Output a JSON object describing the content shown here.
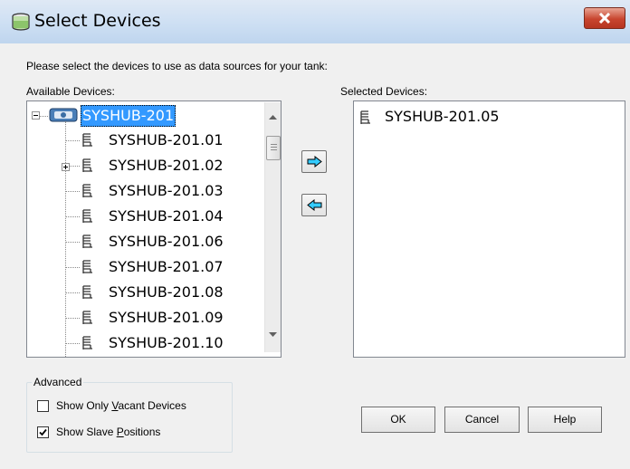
{
  "window": {
    "title": "Select Devices",
    "close_icon": "close-x-icon"
  },
  "instructions": "Please select the devices to use as data sources for your tank:",
  "available": {
    "label": "Available Devices:",
    "root": "SYSHUB-201",
    "items": [
      "SYSHUB-201.01",
      "SYSHUB-201.02",
      "SYSHUB-201.03",
      "SYSHUB-201.04",
      "SYSHUB-201.06",
      "SYSHUB-201.07",
      "SYSHUB-201.08",
      "SYSHUB-201.09",
      "SYSHUB-201.10"
    ]
  },
  "selected": {
    "label": "Selected Devices:",
    "items": [
      "SYSHUB-201.05"
    ]
  },
  "advanced": {
    "title": "Advanced",
    "show_vacant": {
      "label_pre": "Show Only ",
      "label_key": "V",
      "label_post": "acant Devices",
      "checked": false
    },
    "show_slave": {
      "label_pre": "Show Slave ",
      "label_key": "P",
      "label_post": "ositions",
      "checked": true
    }
  },
  "buttons": {
    "ok": "OK",
    "cancel": "Cancel",
    "help": "Help"
  },
  "colors": {
    "selection": "#3399ff",
    "arrow_fill": "#33ccff"
  }
}
